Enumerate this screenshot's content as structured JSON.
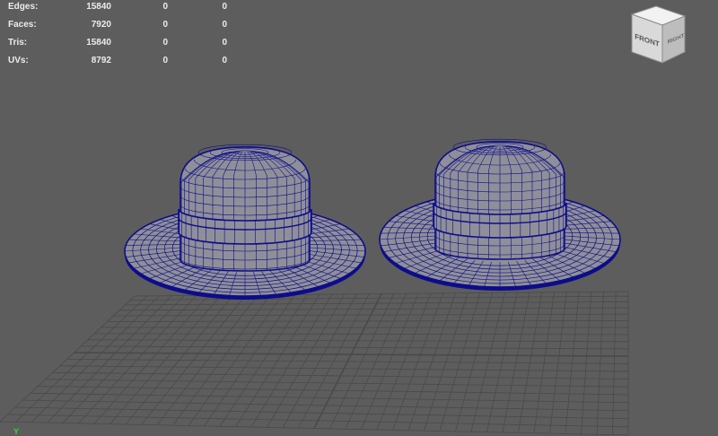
{
  "stats": {
    "rows": [
      {
        "label": "Edges:",
        "values": [
          "15840",
          "0",
          "0"
        ]
      },
      {
        "label": "Faces:",
        "values": [
          "7920",
          "0",
          "0"
        ]
      },
      {
        "label": "Tris:",
        "values": [
          "15840",
          "0",
          "0"
        ]
      },
      {
        "label": "UVs:",
        "values": [
          "8792",
          "0",
          "0"
        ]
      }
    ]
  },
  "viewcube": {
    "front_label": "FRONT",
    "right_label": "RIGHT"
  },
  "axis": {
    "label": "Y"
  },
  "colors": {
    "background": "#5d5d5d",
    "grid": "#4a4a4a",
    "wireframe": "#0d0d8a",
    "hat_surface": "#8f8f99",
    "axis_green": "#37d13d"
  },
  "objects": [
    {
      "name": "hat-left",
      "type": "hat-mesh"
    },
    {
      "name": "hat-right",
      "type": "hat-mesh"
    }
  ]
}
